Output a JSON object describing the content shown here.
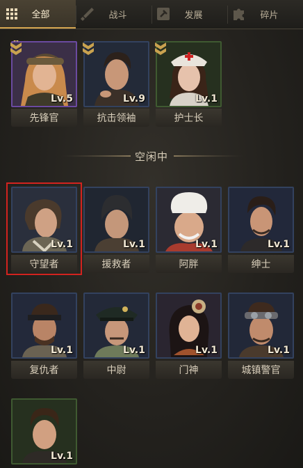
{
  "tabs": [
    {
      "label": "全部",
      "icon": "grid-icon",
      "active": true
    },
    {
      "label": "战斗",
      "icon": "sword-icon",
      "active": false
    },
    {
      "label": "发展",
      "icon": "hammer-icon",
      "active": false
    },
    {
      "label": "碎片",
      "icon": "puzzle-icon",
      "active": false
    }
  ],
  "assigned_heroes": [
    {
      "name": "先锋官",
      "level": "Lv.5",
      "rarity": "purple",
      "badge": "rank-chevron-icon"
    },
    {
      "name": "抗击领袖",
      "level": "Lv.9",
      "rarity": "blue",
      "badge": "rank-chevron-icon"
    },
    {
      "name": "护士长",
      "level": "Lv.1",
      "rarity": "green",
      "badge": "rank-chevron-icon"
    }
  ],
  "idle_section": {
    "title": "空闲中"
  },
  "idle_heroes": [
    {
      "name": "守望者",
      "level": "Lv.1",
      "rarity": "blue",
      "selected": true
    },
    {
      "name": "援救者",
      "level": "Lv.1",
      "rarity": "blue"
    },
    {
      "name": "阿胖",
      "level": "Lv.1",
      "rarity": "blue"
    },
    {
      "name": "绅士",
      "level": "Lv.1",
      "rarity": "blue"
    },
    {
      "name": "复仇者",
      "level": "Lv.1",
      "rarity": "blue"
    },
    {
      "name": "中尉",
      "level": "Lv.1",
      "rarity": "blue"
    },
    {
      "name": "门神",
      "level": "Lv.1",
      "rarity": "blue"
    },
    {
      "name": "城镇警官",
      "level": "Lv.1",
      "rarity": "blue"
    },
    {
      "name": "",
      "level": "Lv.1",
      "rarity": "green"
    }
  ],
  "colors": {
    "accent_gold": "#d5a650",
    "rarity_purple": "#6b4aa0",
    "rarity_blue": "#33425f",
    "rarity_green": "#3f5a31",
    "selection_red": "#d3231f"
  }
}
